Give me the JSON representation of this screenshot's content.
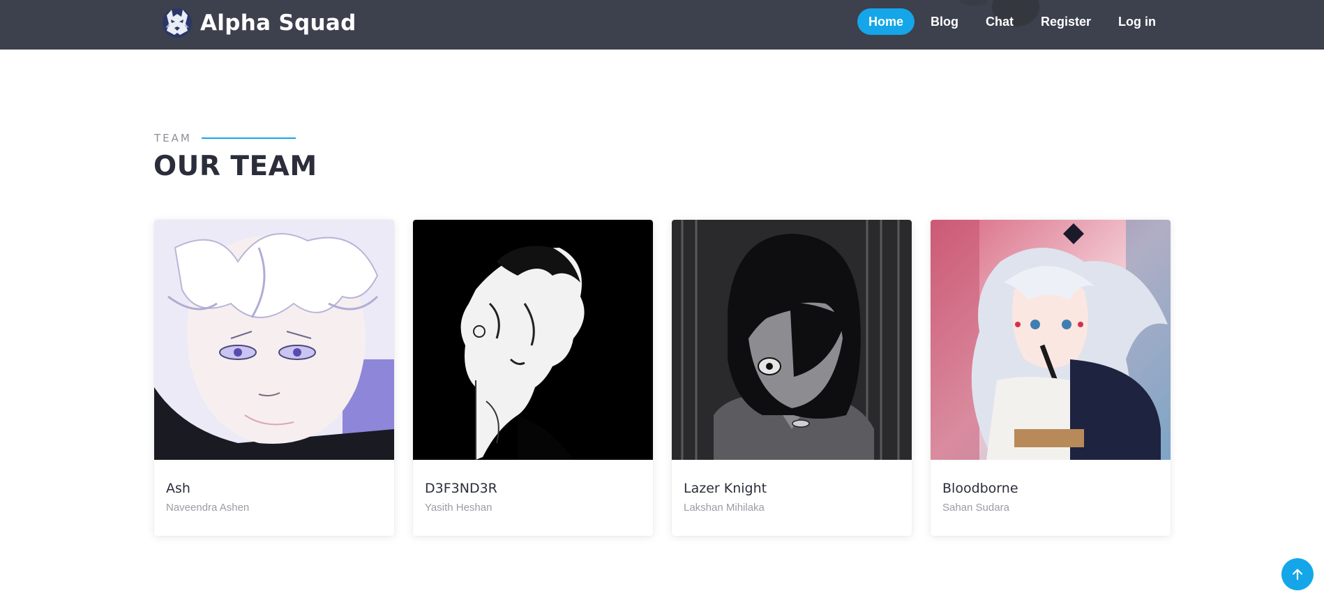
{
  "header": {
    "brand": "Alpha Squad",
    "logo_icon": "wolf-logo-icon",
    "background": "#3d404d",
    "accent": "#14a6e8",
    "nav": [
      {
        "label": "Home",
        "active": true
      },
      {
        "label": "Blog",
        "active": false
      },
      {
        "label": "Chat",
        "active": false
      },
      {
        "label": "Register",
        "active": false
      },
      {
        "label": "Log in",
        "active": false
      }
    ]
  },
  "section": {
    "label": "TEAM",
    "title": "OUR TEAM"
  },
  "team": [
    {
      "name": "Ash",
      "role": "Naveendra Ashen",
      "photo": "white-haired-anime-boy-portrait"
    },
    {
      "name": "D3F3ND3R",
      "role": "Yasith Heshan",
      "photo": "black-white-manga-profile"
    },
    {
      "name": "Lazer Knight",
      "role": "Lakshan Mihilaka",
      "photo": "grayscale-long-haired-anime-character"
    },
    {
      "name": "Bloodborne",
      "role": "Sahan Sudara",
      "photo": "silver-haired-anime-girl-kimono"
    }
  ],
  "back_to_top_icon": "arrow-up-icon"
}
